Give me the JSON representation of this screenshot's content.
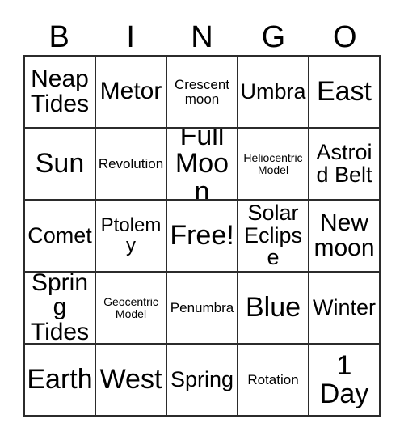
{
  "card": {
    "title": "BINGO",
    "headers": [
      "B",
      "I",
      "N",
      "G",
      "O"
    ],
    "colors": {
      "background": "#ffffff",
      "border": "#2b2b2b",
      "text": "#000000"
    },
    "free_space": "Free!",
    "grid_size": "5x5",
    "rows": [
      [
        {
          "text": "Neap Tides",
          "size": "xl"
        },
        {
          "text": "Metor",
          "size": "xl"
        },
        {
          "text": "Crescent moon",
          "size": "sm"
        },
        {
          "text": "Umbra",
          "size": "lg"
        },
        {
          "text": "East",
          "size": "xxl"
        }
      ],
      [
        {
          "text": "Sun",
          "size": "xxl"
        },
        {
          "text": "Revolution",
          "size": "sm"
        },
        {
          "text": "Full Moon",
          "size": "xxl"
        },
        {
          "text": "Heliocentric Model",
          "size": "xs"
        },
        {
          "text": "Astroid Belt",
          "size": "lg"
        }
      ],
      [
        {
          "text": "Comet",
          "size": "lg"
        },
        {
          "text": "Ptolemy",
          "size": "md"
        },
        {
          "text": "Free!",
          "size": "xxl"
        },
        {
          "text": "Solar Eclipse",
          "size": "lg"
        },
        {
          "text": "New moon",
          "size": "xl"
        }
      ],
      [
        {
          "text": "Spring Tides",
          "size": "xl"
        },
        {
          "text": "Geocentric Model",
          "size": "xs"
        },
        {
          "text": "Penumbra",
          "size": "sm"
        },
        {
          "text": "Blue",
          "size": "xxl"
        },
        {
          "text": "Winter",
          "size": "lg"
        }
      ],
      [
        {
          "text": "Earth",
          "size": "xxl"
        },
        {
          "text": "West",
          "size": "xxl"
        },
        {
          "text": "Spring",
          "size": "lg"
        },
        {
          "text": "Rotation",
          "size": "sm"
        },
        {
          "text": "1 Day",
          "size": "xxl"
        }
      ]
    ]
  }
}
